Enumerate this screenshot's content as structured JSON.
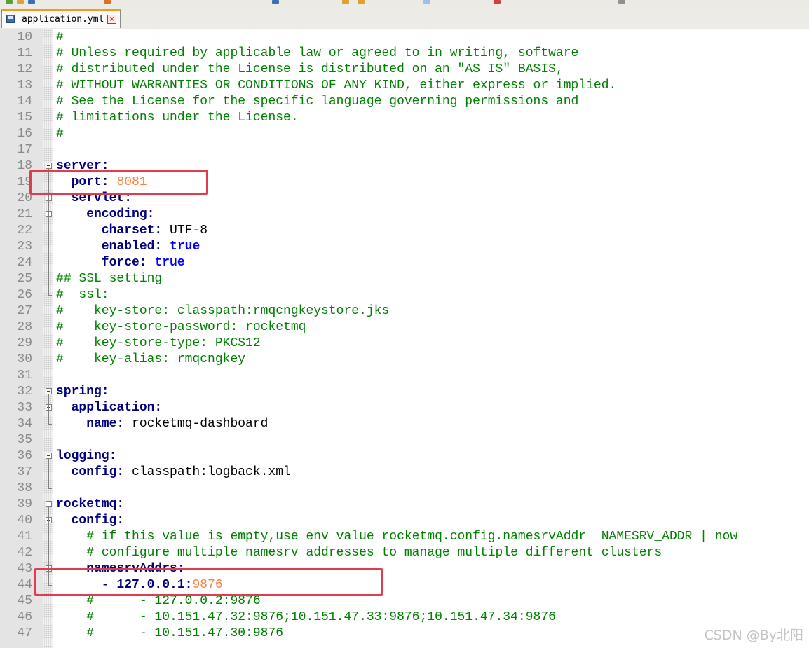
{
  "tab": {
    "filename": "application.yml",
    "close_glyph": "×"
  },
  "lines": [
    {
      "n": "10",
      "segs": [
        {
          "t": "#",
          "c": "comment"
        }
      ]
    },
    {
      "n": "11",
      "segs": [
        {
          "t": "# Unless required by applicable law or agreed to in writing, software",
          "c": "comment"
        }
      ]
    },
    {
      "n": "12",
      "segs": [
        {
          "t": "# distributed under the License is distributed on an \"AS IS\" BASIS,",
          "c": "comment"
        }
      ]
    },
    {
      "n": "13",
      "segs": [
        {
          "t": "# WITHOUT WARRANTIES OR CONDITIONS OF ANY KIND, either express or implied.",
          "c": "comment"
        }
      ]
    },
    {
      "n": "14",
      "segs": [
        {
          "t": "# See the License for the specific language governing permissions and",
          "c": "comment"
        }
      ]
    },
    {
      "n": "15",
      "segs": [
        {
          "t": "# limitations under the License.",
          "c": "comment"
        }
      ]
    },
    {
      "n": "16",
      "segs": [
        {
          "t": "#",
          "c": "comment"
        }
      ]
    },
    {
      "n": "17",
      "segs": []
    },
    {
      "n": "18",
      "fold": "start",
      "segs": [
        {
          "t": "server:",
          "c": "key"
        }
      ]
    },
    {
      "n": "19",
      "segs": [
        {
          "t": "  port:",
          "c": "key"
        },
        {
          "t": " ",
          "c": "text"
        },
        {
          "t": "8081",
          "c": "num"
        }
      ]
    },
    {
      "n": "20",
      "fold": "start",
      "segs": [
        {
          "t": "  servlet:",
          "c": "key"
        }
      ]
    },
    {
      "n": "21",
      "fold": "start",
      "segs": [
        {
          "t": "    encoding:",
          "c": "key"
        }
      ]
    },
    {
      "n": "22",
      "segs": [
        {
          "t": "      charset:",
          "c": "key"
        },
        {
          "t": " UTF-8",
          "c": "text"
        }
      ]
    },
    {
      "n": "23",
      "segs": [
        {
          "t": "      enabled:",
          "c": "key"
        },
        {
          "t": " ",
          "c": "text"
        },
        {
          "t": "true",
          "c": "bool"
        }
      ]
    },
    {
      "n": "24",
      "fold": "end",
      "segs": [
        {
          "t": "      force:",
          "c": "key"
        },
        {
          "t": " ",
          "c": "text"
        },
        {
          "t": "true",
          "c": "bool"
        }
      ]
    },
    {
      "n": "25",
      "segs": [
        {
          "t": "## SSL setting",
          "c": "comment"
        }
      ]
    },
    {
      "n": "26",
      "segs": [
        {
          "t": "#  ssl:",
          "c": "comment"
        }
      ]
    },
    {
      "n": "27",
      "segs": [
        {
          "t": "#    key-store: classpath:rmqcngkeystore.jks",
          "c": "comment"
        }
      ]
    },
    {
      "n": "28",
      "segs": [
        {
          "t": "#    key-store-password: rocketmq",
          "c": "comment"
        }
      ]
    },
    {
      "n": "29",
      "segs": [
        {
          "t": "#    key-store-type: PKCS12",
          "c": "comment"
        }
      ]
    },
    {
      "n": "30",
      "segs": [
        {
          "t": "#    key-alias: rmqcngkey",
          "c": "comment"
        }
      ]
    },
    {
      "n": "31",
      "segs": []
    },
    {
      "n": "32",
      "fold": "start",
      "segs": [
        {
          "t": "spring:",
          "c": "key"
        }
      ]
    },
    {
      "n": "33",
      "fold": "start",
      "segs": [
        {
          "t": "  application:",
          "c": "key"
        }
      ]
    },
    {
      "n": "34",
      "segs": [
        {
          "t": "    name:",
          "c": "key"
        },
        {
          "t": " rocketmq-dashboard",
          "c": "text"
        }
      ]
    },
    {
      "n": "35",
      "segs": []
    },
    {
      "n": "36",
      "fold": "start",
      "segs": [
        {
          "t": "logging:",
          "c": "key"
        }
      ]
    },
    {
      "n": "37",
      "segs": [
        {
          "t": "  config:",
          "c": "key"
        },
        {
          "t": " classpath:logback.xml",
          "c": "text"
        }
      ]
    },
    {
      "n": "38",
      "fold": "end",
      "segs": []
    },
    {
      "n": "39",
      "fold": "start",
      "segs": [
        {
          "t": "rocketmq:",
          "c": "key"
        }
      ]
    },
    {
      "n": "40",
      "fold": "start",
      "segs": [
        {
          "t": "  config:",
          "c": "key"
        }
      ]
    },
    {
      "n": "41",
      "segs": [
        {
          "t": "    # if this value is empty,use env value rocketmq.config.namesrvAddr  NAMESRV_ADDR | now",
          "c": "comment"
        }
      ]
    },
    {
      "n": "42",
      "segs": [
        {
          "t": "    # configure multiple namesrv addresses to manage multiple different clusters",
          "c": "comment"
        }
      ]
    },
    {
      "n": "43",
      "fold": "start",
      "segs": [
        {
          "t": "    namesrvAddrs:",
          "c": "key"
        }
      ]
    },
    {
      "n": "44",
      "fold": "end",
      "segs": [
        {
          "t": "      - 127.0.0.1:",
          "c": "key"
        },
        {
          "t": "9876",
          "c": "num"
        }
      ]
    },
    {
      "n": "45",
      "segs": [
        {
          "t": "    #      - 127.0.0.2:9876",
          "c": "comment"
        }
      ]
    },
    {
      "n": "46",
      "segs": [
        {
          "t": "    #      - 10.151.47.32:9876;10.151.47.33:9876;10.151.47.34:9876",
          "c": "comment"
        }
      ]
    },
    {
      "n": "47",
      "segs": [
        {
          "t": "    #      - 10.151.47.30:9876",
          "c": "comment"
        }
      ]
    }
  ],
  "watermark": "CSDN @By北阳"
}
